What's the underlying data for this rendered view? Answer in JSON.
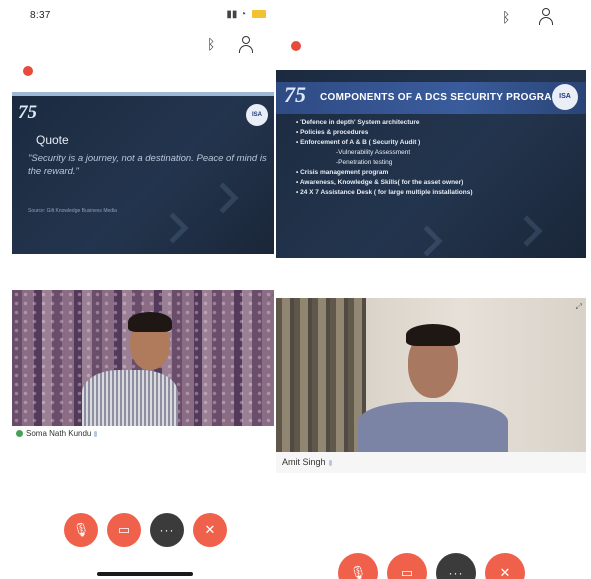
{
  "left_phone": {
    "status_time": "8:37",
    "slide": {
      "heading": "Quote",
      "quote": "\"Security is a journey, not a destination. Peace of mind is the reward.\"",
      "source": "Source: Gilt Knowledge Business Media"
    },
    "participant": {
      "name": "Soma Nath Kundu"
    }
  },
  "right_phone": {
    "slide": {
      "title": "COMPONENTS OF A DCS SECURITY PROGRAM",
      "bullets": [
        "• 'Defence  in depth' System architecture",
        "• Policies & procedures",
        "• Enforcement of A & B ( Security Audit )",
        "-Vulnerability Assessment",
        "-Penetration testing",
        "• Crisis management program",
        "• Awareness, Knowledge & Skills( for the asset owner)",
        "• 24 X 7 Assistance Desk ( for large multiple installations)"
      ]
    },
    "participant": {
      "name": "Amit Singh"
    }
  },
  "brand": {
    "logo_text": "75",
    "isa_text": "ISA",
    "accent": "#f0614b",
    "rec": "#e84a3b"
  },
  "controls": {
    "more_label": "···"
  },
  "icons": [
    "bluetooth-icon",
    "participants-icon",
    "mic-off-icon",
    "video-off-icon",
    "more-icon",
    "end-call-icon",
    "record-icon"
  ]
}
